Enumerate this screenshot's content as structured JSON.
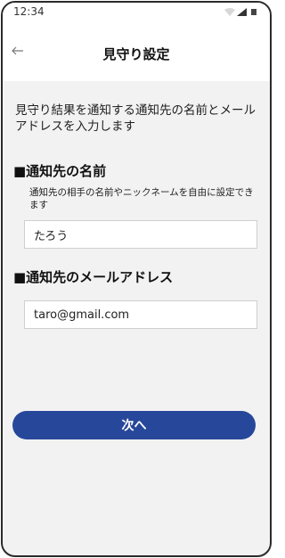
{
  "status_bar": {
    "time": "12:34"
  },
  "app_bar": {
    "back_icon": "arrow-left-icon",
    "title": "見守り設定"
  },
  "intro_text": "見守り結果を通知する通知先の名前とメールアドレスを入力します",
  "name_section": {
    "title": "■通知先の名前",
    "note": "通知先の相手の名前やニックネームを自由に設定できます",
    "value": "たろう"
  },
  "email_section": {
    "title": "■通知先のメールアドレス",
    "value": "taro@gmail.com"
  },
  "next_button": {
    "label": "次へ",
    "color": "#27479a"
  }
}
